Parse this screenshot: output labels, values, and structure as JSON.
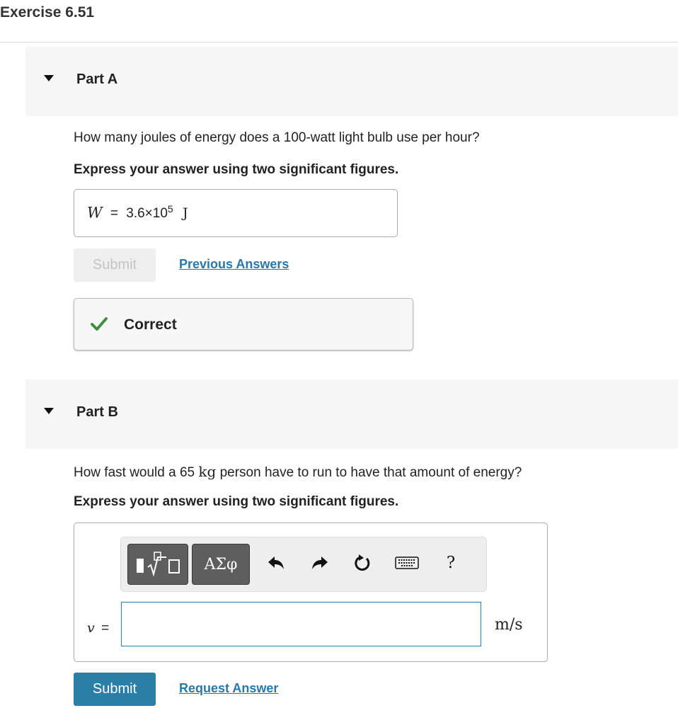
{
  "page": {
    "title": "Exercise 6.51"
  },
  "part_a": {
    "label": "Part A",
    "question": "How many joules of energy does a 100-watt light bulb use per hour?",
    "instruction": "Express your answer using two significant figures.",
    "answer": {
      "variable": "W",
      "equals": "=",
      "mantissa": "3.6×10",
      "exponent": "5",
      "unit": "J"
    },
    "submit_label": "Submit",
    "previous_answers_label": "Previous Answers",
    "feedback": {
      "status": "Correct",
      "icon": "check-icon",
      "color": "#3e8e3e"
    }
  },
  "part_b": {
    "label": "Part B",
    "question_before": "How fast would a 65 ",
    "question_unit": "kg",
    "question_after": " person have to run to have that amount of energy?",
    "instruction": "Express your answer using two significant figures.",
    "toolbar": {
      "template_icon": "template-sqrt-icon",
      "greek_label": "ΑΣφ",
      "undo_icon": "undo-icon",
      "redo_icon": "redo-icon",
      "reset_icon": "reset-icon",
      "keyboard_icon": "keyboard-icon",
      "help_label": "?"
    },
    "variable": "v",
    "equals": "=",
    "input_value": "",
    "unit": "m/s",
    "submit_label": "Submit",
    "request_answer_label": "Request Answer"
  },
  "colors": {
    "accent": "#2b7ea6",
    "link": "#2a78a6",
    "header_bg": "#f6f6f6"
  }
}
